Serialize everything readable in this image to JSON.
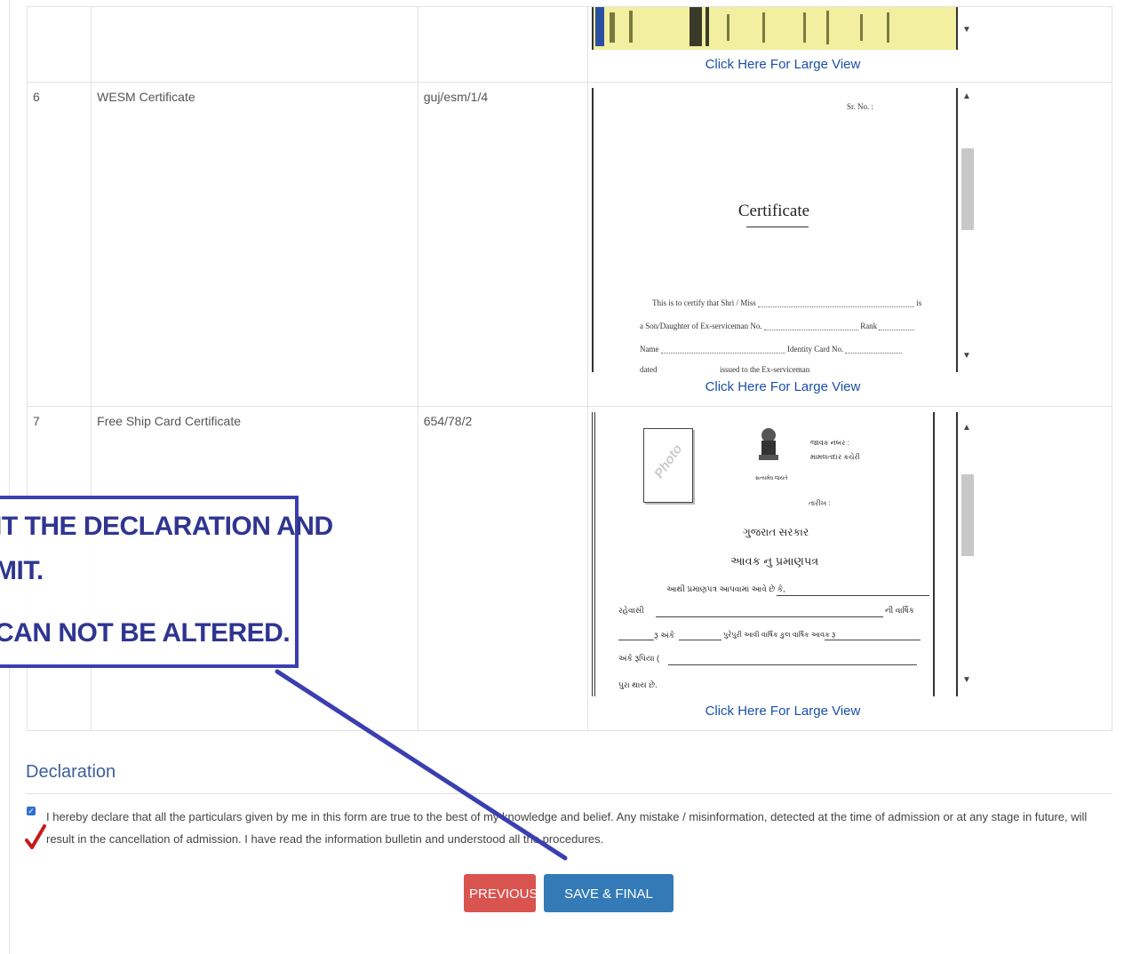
{
  "documents": {
    "rows": [
      {
        "no": "6",
        "name": "WESM Certificate",
        "number": "guj/esm/1/4",
        "link": "Click Here For Large View"
      },
      {
        "no": "7",
        "name": "Free Ship Card Certificate",
        "number": "654/78/2",
        "link": "Click Here For Large View"
      }
    ],
    "top_link": "Click Here For Large View"
  },
  "wesm_preview": {
    "sr_no": "Sr. No. :",
    "title": "Certificate",
    "line1": "This is to certify that Shri / Miss",
    "line1_end": "is",
    "line2": "a Son/Daughter of Ex-serviceman No.",
    "line2_rank": "Rank",
    "line3": "Name",
    "line3_id": "Identity Card No.",
    "line4": "dated",
    "line4_mid": "issued to the Ex-serviceman"
  },
  "freeship_preview": {
    "photo_label": "Photo",
    "head1": "જાવક નંબર :",
    "head2": "મામલતદાર કચેરી",
    "emblem_caption": "સત્યમેવ જયતે",
    "date_label": "તારીખ :",
    "gov": "ગુજરાત સરકાર",
    "title": "આવક નુ પ્રમાણપત્ર",
    "line1": "આથી પ્રમાણપત્ર આપવામાં આવે છે કે,",
    "line2a": "રહેવાસી",
    "line2b": "ની વાર્ષિક",
    "line3a": "રૂ અંકે",
    "line3b": "પુરેપુરી આવી વાર્ષિક કુલ વાર્ષિક આવક રૂ",
    "line4": "અંકે રૂપિયા (",
    "line5": "પુરા થાય છે."
  },
  "declaration": {
    "title": "Declaration",
    "text": "I hereby declare that all the particulars given by me in this form are true to the best of my knowledge and belief. Any mistake / misinformation, detected at the time of admission or at any stage in future, will result in the cancellation of admission. I have read the information bulletin and understood all the procedures."
  },
  "buttons": {
    "previous": "PREVIOUS",
    "submit": "SAVE & FINAL SUBMIT"
  },
  "callout": {
    "line1": "IT THE DECLARATION AND",
    "line2": "MIT.",
    "line3": "CAN NOT BE ALTERED."
  },
  "colors": {
    "link": "#1a4fa8",
    "previous_button": "#d9534f",
    "submit_button": "#337ab7",
    "callout": "#2f3590",
    "declaration_title": "#3b5f9a"
  }
}
